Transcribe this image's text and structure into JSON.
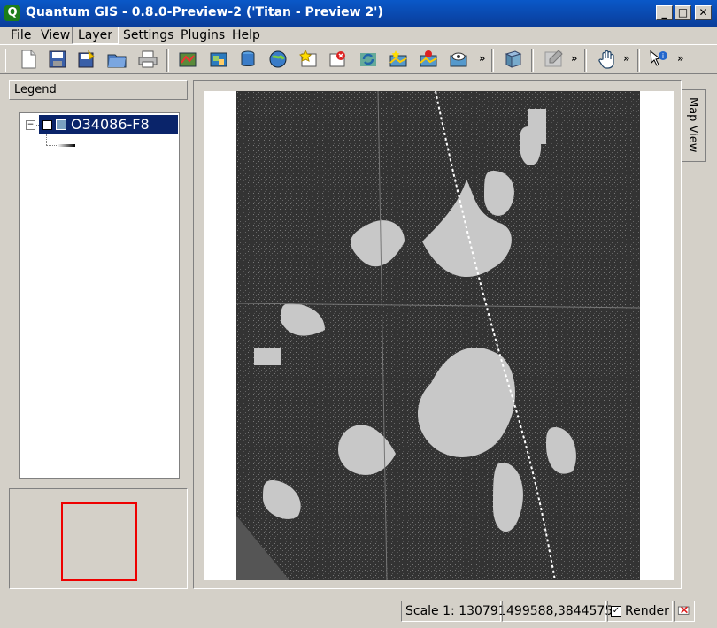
{
  "window": {
    "title": "Quantum GIS - 0.8.0-Preview-2 ('Titan - Preview 2')",
    "app_icon": "Q",
    "minimize": "_",
    "maximize": "□",
    "close": "✕"
  },
  "menu": [
    {
      "label": "File"
    },
    {
      "label": "View"
    },
    {
      "label": "Layer"
    },
    {
      "label": "Settings"
    },
    {
      "label": "Plugins"
    },
    {
      "label": "Help"
    }
  ],
  "toolbar": {
    "overflow": "»"
  },
  "legend": {
    "title": "Legend",
    "layer_name": "O34086-F8",
    "tree_toggle": "−"
  },
  "map": {
    "tab_label": "Map View"
  },
  "status": {
    "scale": "Scale 1: 130791",
    "coords": "499588,3844575",
    "render_label": "Render",
    "render_checked": "✓"
  },
  "colors": {
    "titlebar": "#0a3d9a",
    "selection": "#0a246a",
    "map_dark": "#333333",
    "map_light": "#c8c8c8",
    "extent": "#ee0000"
  }
}
